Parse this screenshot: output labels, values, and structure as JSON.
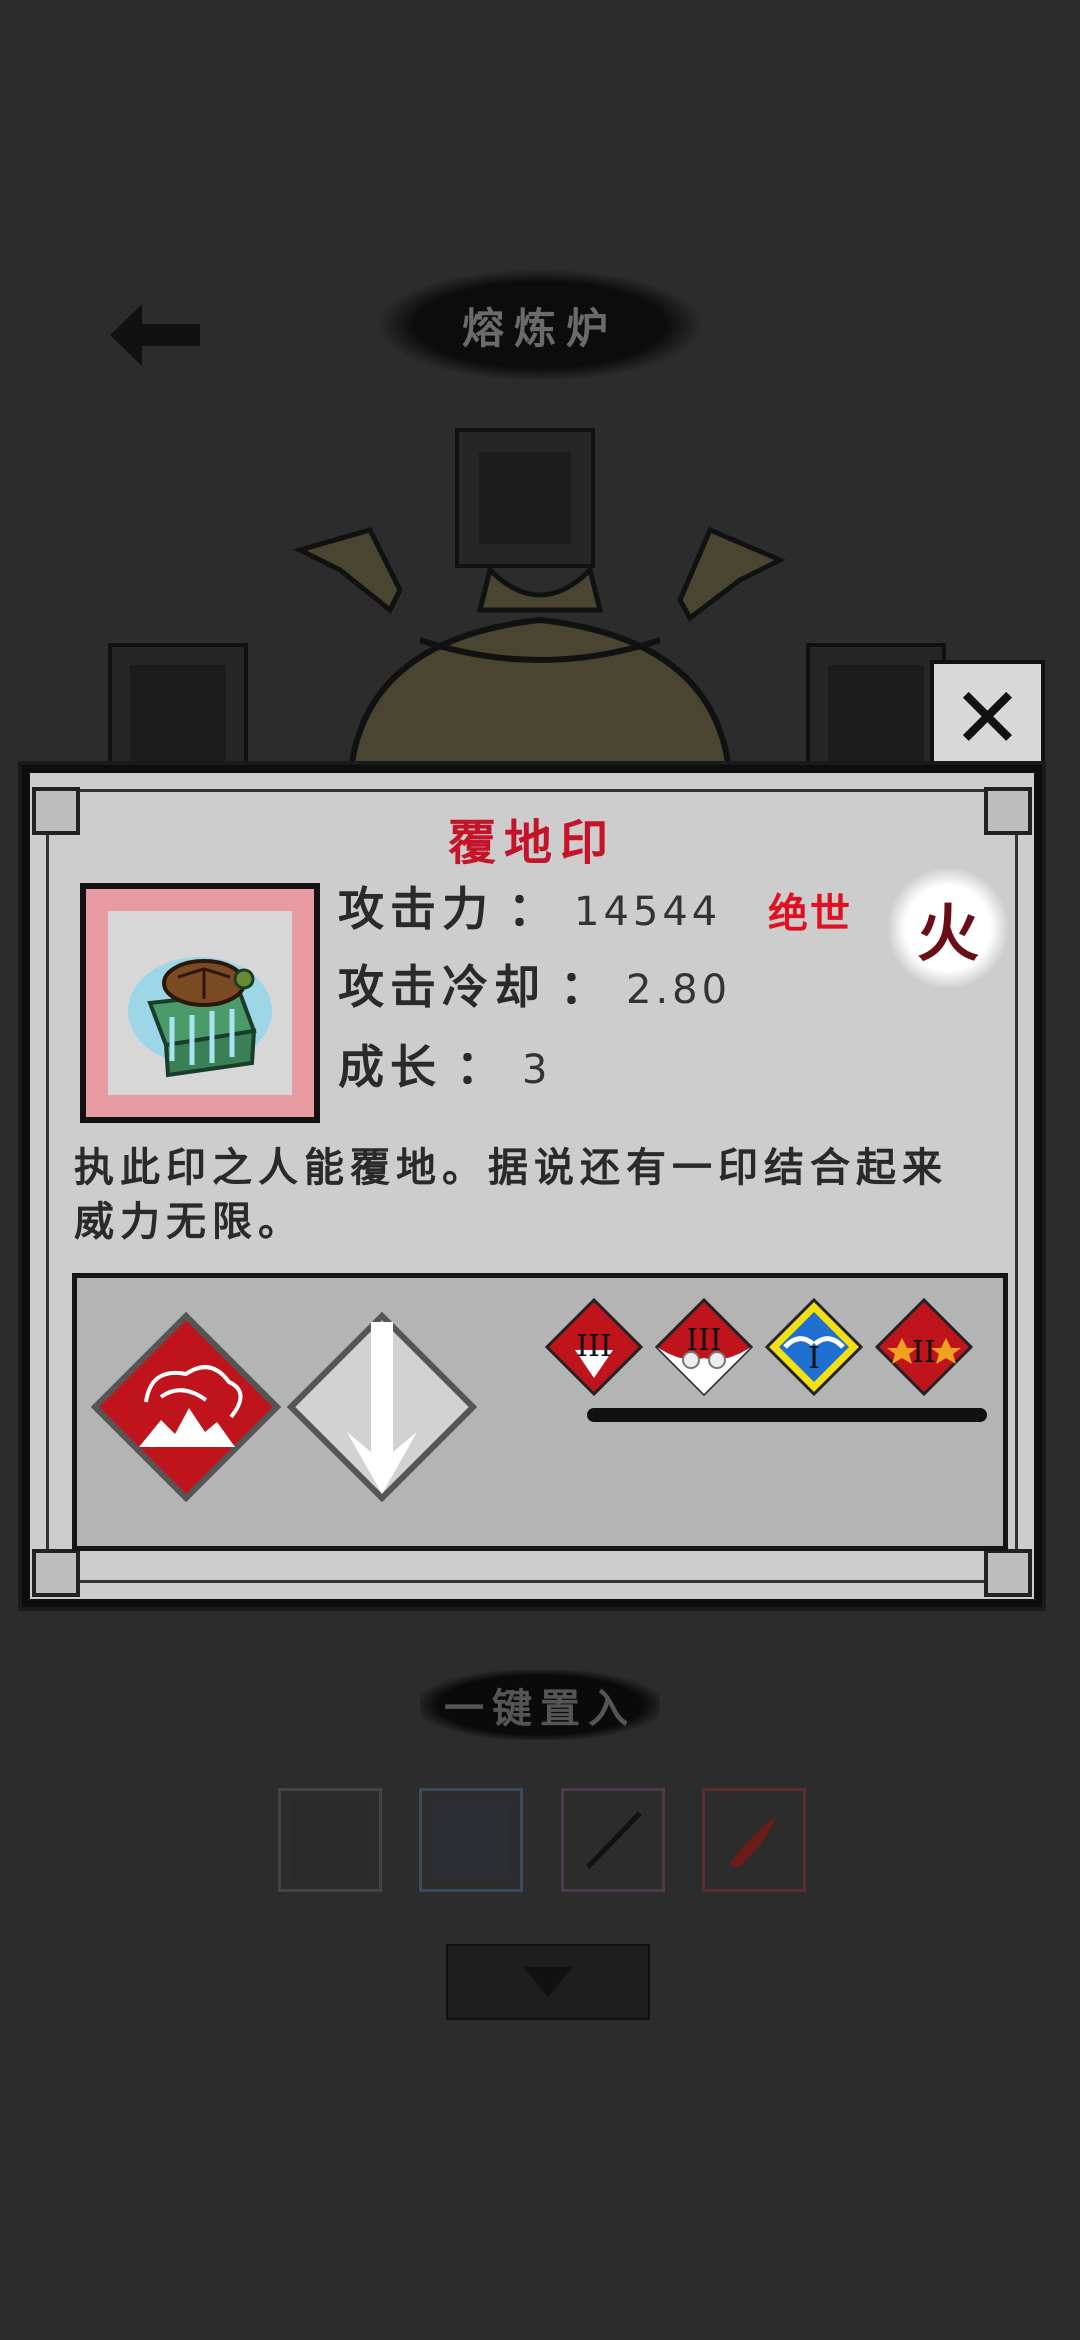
{
  "header": {
    "title": "熔炼炉",
    "back_icon": "back-arrow-icon"
  },
  "modal": {
    "close_icon": "close-icon",
    "item_name": "覆地印",
    "stats": [
      {
        "label": "攻击力",
        "value": "14544"
      },
      {
        "label": "攻击冷却",
        "value": "2.80"
      },
      {
        "label": "成长",
        "value": "3"
      }
    ],
    "separator": "：",
    "grade": "绝世",
    "element": "火",
    "description": "执此印之人能覆地。据说还有一印结合起来威力无限。",
    "skills": {
      "main_icon": "earth-shock-skill-icon",
      "secondary_icon": "down-arrow-skill-icon",
      "badges": [
        {
          "icon": "rank-badge-III-plus-icon",
          "text": "III"
        },
        {
          "icon": "rank-badge-III-lotus-icon",
          "text": "III"
        },
        {
          "icon": "rank-badge-I-wings-icon",
          "text": "I"
        },
        {
          "icon": "rank-badge-II-stars-icon",
          "text": "II"
        }
      ]
    }
  },
  "footer": {
    "one_key_label": "一键置入",
    "down_icon": "chevron-down-icon"
  },
  "colors": {
    "item_name": "#c4142a",
    "grade": "#e01020",
    "element": "#6b0d16",
    "panel": "#cdcdcd"
  }
}
